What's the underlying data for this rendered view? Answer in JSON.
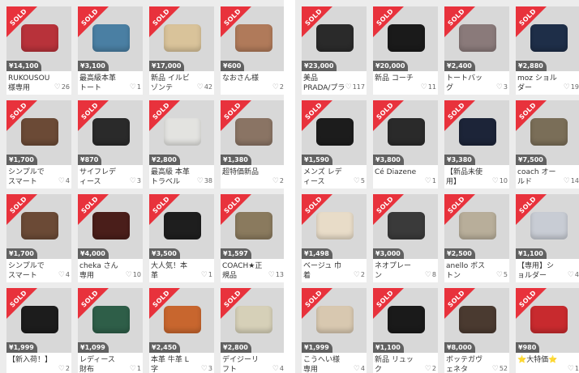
{
  "sold_label": "SOLD",
  "heart_icon": "♡",
  "colors": {
    "sold_ribbon": "#e8323c",
    "price_bg": "#000000"
  },
  "left_items": [
    {
      "price": "¥14,100",
      "title": "RUKOUSOU様専用",
      "likes": "26",
      "color": "#b8323a"
    },
    {
      "price": "¥3,100",
      "title": "最高級本革トート",
      "likes": "1",
      "color": "#4a7fa3"
    },
    {
      "price": "¥17,000",
      "title": "新品 イルビゾンテ",
      "likes": "42",
      "color": "#d9c39a"
    },
    {
      "price": "¥600",
      "title": "なおさん様",
      "likes": "2",
      "color": "#b07a5a"
    },
    {
      "price": "¥1,700",
      "title": "シンプルでスマート",
      "likes": "4",
      "color": "#6b4a36"
    },
    {
      "price": "¥870",
      "title": "サイフレディース",
      "likes": "3",
      "color": "#2a2a2a"
    },
    {
      "price": "¥2,800",
      "title": "最高級 本革 トラベル",
      "likes": "38",
      "color": "#e3e3e0"
    },
    {
      "price": "¥1,380",
      "title": "超特価新品",
      "likes": "2",
      "color": "#8a7464"
    },
    {
      "price": "¥1,700",
      "title": "シンプルでスマート",
      "likes": "4",
      "color": "#6b4a36"
    },
    {
      "price": "¥4,000",
      "title": "cheka さん専用",
      "likes": "10",
      "color": "#4a1e1a"
    },
    {
      "price": "¥3,500",
      "title": "大人気！本革",
      "likes": "1",
      "color": "#1e1e1e"
    },
    {
      "price": "¥1,597",
      "title": "COACH★正規品",
      "likes": "13",
      "color": "#8a7a5e"
    },
    {
      "price": "¥1,999",
      "title": "【新入荷！】",
      "likes": "2",
      "color": "#1c1c1c"
    },
    {
      "price": "¥1,099",
      "title": "レディース財布",
      "likes": "1",
      "color": "#2e5e48"
    },
    {
      "price": "¥2,450",
      "title": "本革 牛革 L字",
      "likes": "3",
      "color": "#c8662e"
    },
    {
      "price": "¥2,800",
      "title": "デイジーリフト",
      "likes": "4",
      "color": "#d6d0b8"
    }
  ],
  "right_items": [
    {
      "price": "¥23,000",
      "title": "美品 PRADA/プラダ",
      "likes": "117",
      "color": "#2a2a2a"
    },
    {
      "price": "¥20,000",
      "title": "新品 コーチ",
      "likes": "11",
      "color": "#1a1a1a"
    },
    {
      "price": "¥2,400",
      "title": "トートバッグ",
      "likes": "3",
      "color": "#8a7a7a"
    },
    {
      "price": "¥2,880",
      "title": "moz ショルダー",
      "likes": "19",
      "color": "#1e2e48"
    },
    {
      "price": "¥1,590",
      "title": "メンズ レディース",
      "likes": "5",
      "color": "#1c1c1c"
    },
    {
      "price": "¥3,800",
      "title": "Cé Diazene",
      "likes": "1",
      "color": "#2a2a2a"
    },
    {
      "price": "¥3,380",
      "title": "【新品未使用】",
      "likes": "10",
      "color": "#1c2438"
    },
    {
      "price": "¥7,500",
      "title": "coach オールド",
      "likes": "14",
      "color": "#7a6e58"
    },
    {
      "price": "¥1,498",
      "title": "ベージュ 巾着",
      "likes": "2",
      "color": "#e8dcc8"
    },
    {
      "price": "¥3,000",
      "title": "ネオプレーン",
      "likes": "8",
      "color": "#3a3a3a"
    },
    {
      "price": "¥2,500",
      "title": "anello ボストン",
      "likes": "5",
      "color": "#b8ae9a"
    },
    {
      "price": "¥1,100",
      "title": "【専用】ショルダー",
      "likes": "4",
      "color": "#c8ccd4"
    },
    {
      "price": "¥1,999",
      "title": "こうへい様専用",
      "likes": "4",
      "color": "#d8c8b0"
    },
    {
      "price": "¥1,100",
      "title": "新品 リュック",
      "likes": "2",
      "color": "#1a1a1a"
    },
    {
      "price": "¥8,000",
      "title": "ボッテガヴェネタ",
      "likes": "52",
      "color": "#4a3a30"
    },
    {
      "price": "¥980",
      "title": "⭐大特価⭐",
      "likes": "1",
      "color": "#c82a2e"
    }
  ]
}
